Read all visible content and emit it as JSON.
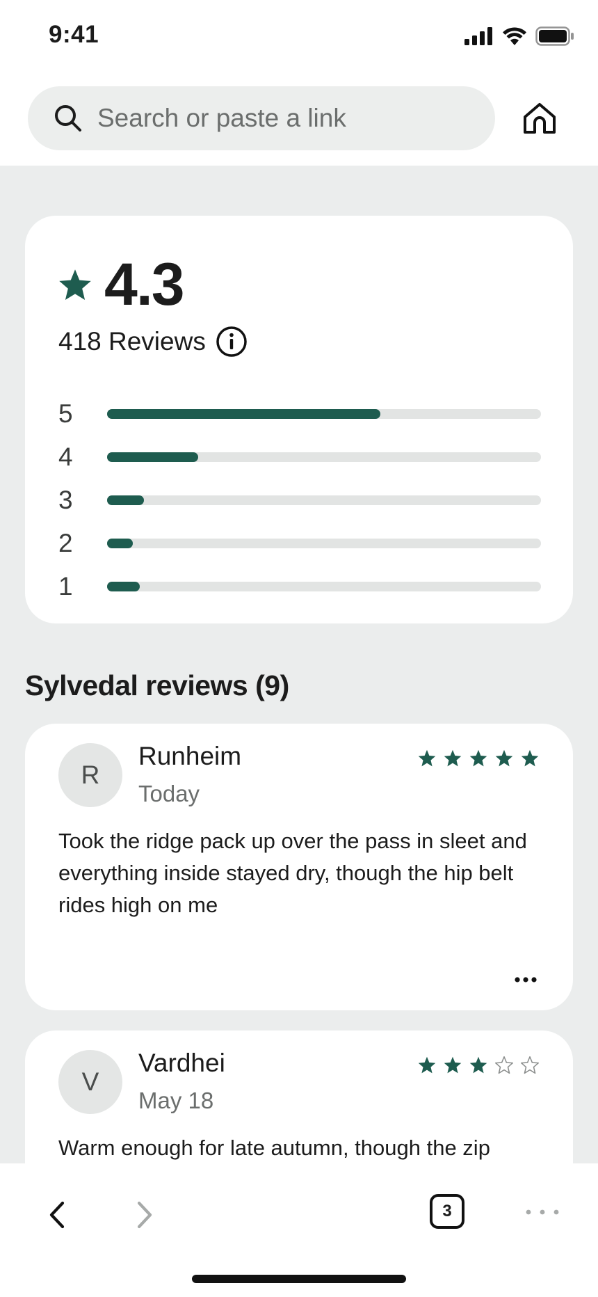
{
  "status_bar": {
    "time": "9:41"
  },
  "search": {
    "placeholder": "Search or paste a link"
  },
  "rating": {
    "value": "4.3",
    "reviews_label": "418 Reviews",
    "distribution": [
      {
        "label": "5",
        "fraction": 0.63
      },
      {
        "label": "4",
        "fraction": 0.21
      },
      {
        "label": "3",
        "fraction": 0.085
      },
      {
        "label": "2",
        "fraction": 0.06
      },
      {
        "label": "1",
        "fraction": 0.075
      }
    ],
    "accent_color": "#1e5c4f"
  },
  "section": {
    "title": "Sylvedal reviews (9)"
  },
  "reviews": [
    {
      "initial": "R",
      "name": "Runheim",
      "date": "Today",
      "stars": 5,
      "text": "Took the ridge pack up over the pass in sleet and everything inside stayed dry, though the hip belt rides high on me"
    },
    {
      "initial": "V",
      "name": "Vardhei",
      "date": "May 18",
      "stars": 3,
      "text": "Warm enough for late autumn, though the zip"
    }
  ],
  "toolbar": {
    "tab_count": "3"
  },
  "icons": {
    "search": "search-icon",
    "home": "home-icon",
    "star": "star-icon",
    "info": "info-icon",
    "more": "more-horizontal-icon",
    "back": "chevron-left-icon",
    "forward": "chevron-right-icon",
    "tabs": "tabs-icon",
    "menu": "menu-dots-icon"
  }
}
